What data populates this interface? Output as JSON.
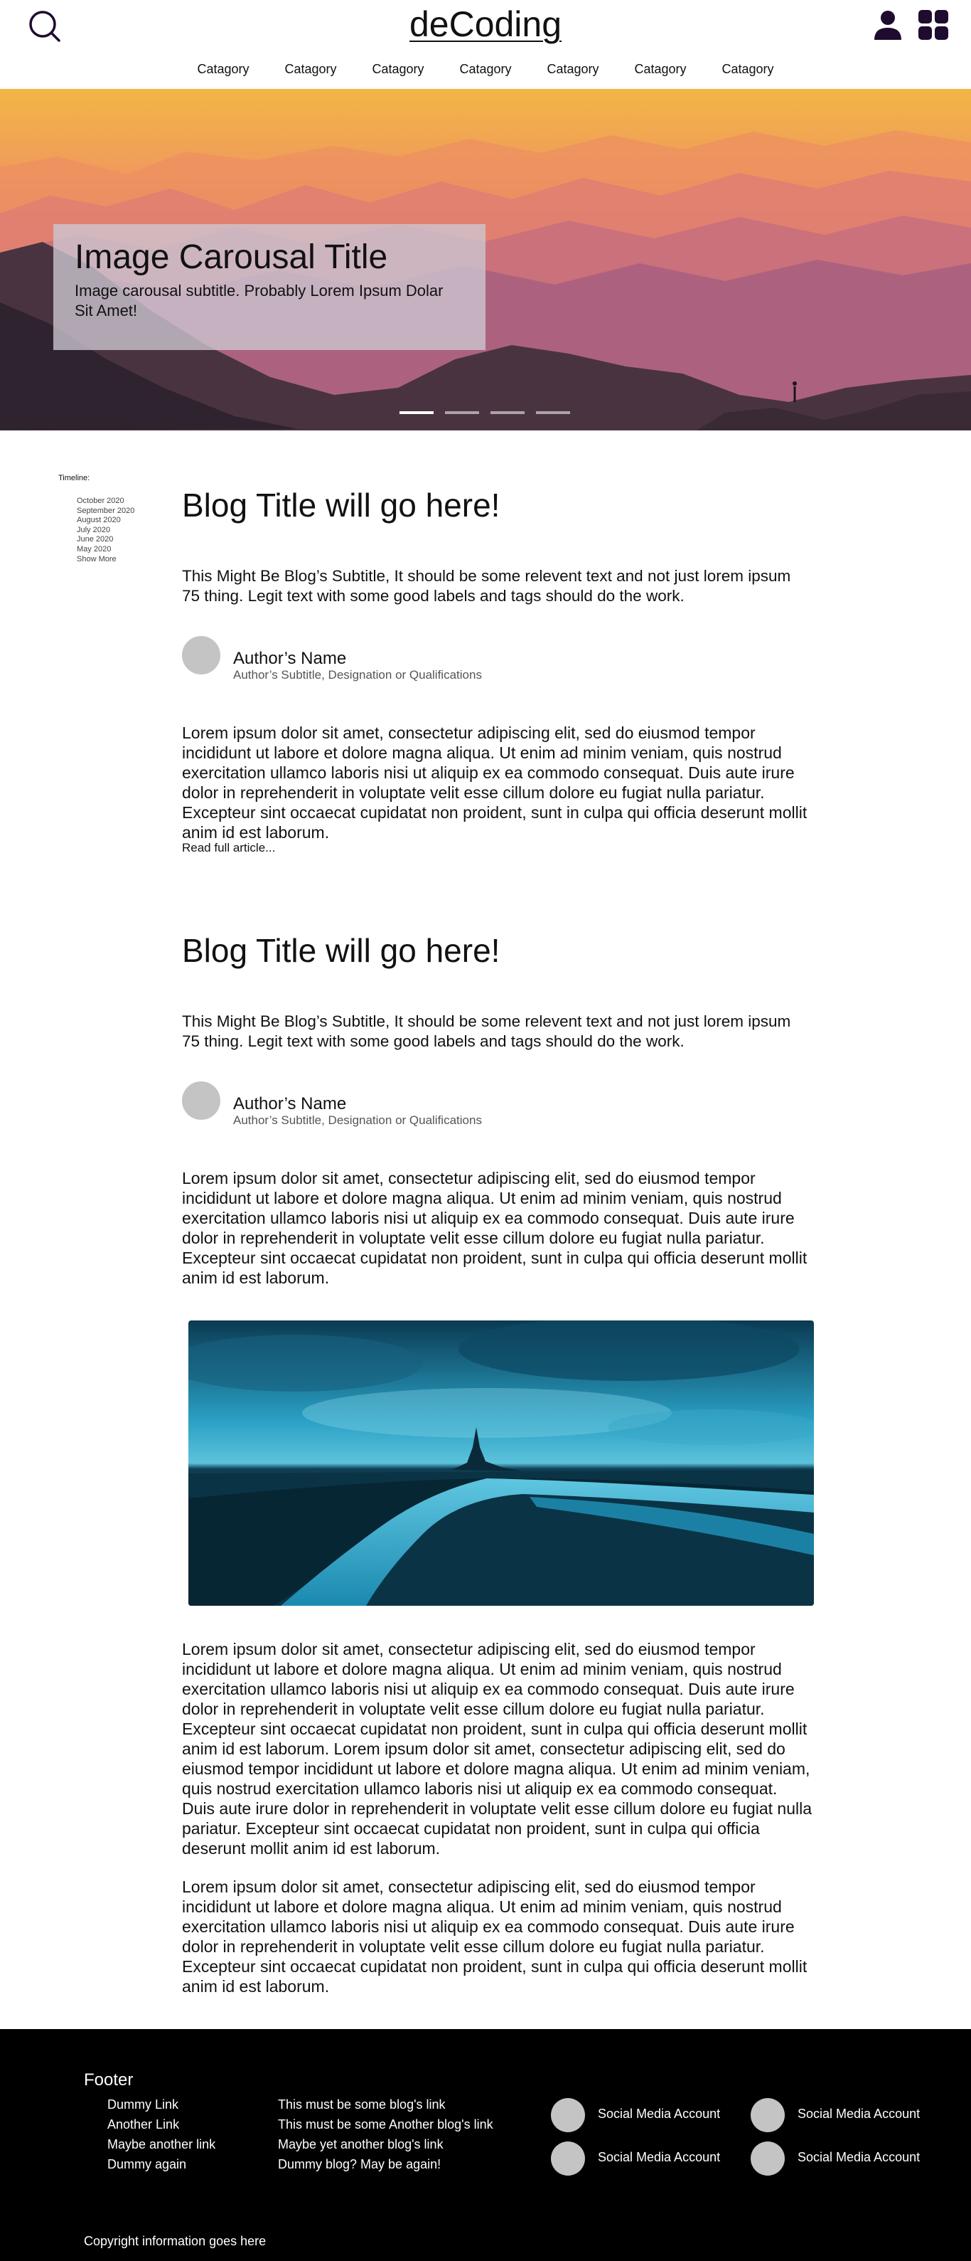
{
  "header": {
    "logo": "deCoding",
    "nav": [
      "Catagory",
      "Catagory",
      "Catagory",
      "Catagory",
      "Catagory",
      "Catagory",
      "Catagory"
    ],
    "icons": [
      "search-icon",
      "user-icon",
      "apps-grid-icon"
    ]
  },
  "hero": {
    "title": "Image Carousal Title",
    "subtitle": "Image carousal subtitle. Probably Lorem Ipsum Dolar Sit Amet!",
    "slides_count": 4,
    "active_slide": 1
  },
  "timeline": {
    "label": "Timeline:",
    "items": [
      "October 2020",
      "September 2020",
      "August 2020",
      "July 2020",
      "June 2020",
      "May 2020"
    ],
    "more": "Show More"
  },
  "articles": [
    {
      "title": "Blog Title will go here!",
      "subtitle": "This Might Be Blog’s Subtitle, It should be some relevent text and not just lorem ipsum 75 thing. Legit text with some good labels and tags should do the work.",
      "author_name": "Author’s Name",
      "author_subtitle": "Author’s Subtitle, Designation or Qualifications",
      "excerpt": "Lorem ipsum dolor sit amet, consectetur adipiscing elit, sed do eiusmod tempor incididunt ut labore et dolore magna aliqua. Ut enim ad minim veniam, quis nostrud exercitation ullamco laboris nisi ut aliquip ex ea commodo consequat. Duis aute irure dolor in reprehenderit in voluptate velit esse cillum dolore eu fugiat nulla pariatur. Excepteur sint occaecat cupidatat non proident, sunt in culpa qui officia deserunt mollit anim id est laborum.",
      "read_more": "Read full article..."
    },
    {
      "title": "Blog Title will go here!",
      "subtitle": "This Might Be Blog’s Subtitle, It should be some relevent text and not just lorem ipsum 75 thing. Legit text with some good labels and tags should do the work.",
      "author_name": "Author’s Name",
      "author_subtitle": "Author’s Subtitle, Designation or Qualifications",
      "paragraph_1": "Lorem ipsum dolor sit amet, consectetur adipiscing elit, sed do eiusmod tempor incididunt ut labore et dolore magna aliqua. Ut enim ad minim veniam, quis nostrud exercitation ullamco laboris nisi ut aliquip ex ea commodo consequat. Duis aute irure dolor in reprehenderit in voluptate velit esse cillum dolore eu fugiat nulla pariatur. Excepteur sint occaecat cupidatat non proident, sunt in culpa qui officia deserunt mollit anim id est laborum.",
      "paragraph_2": "Lorem ipsum dolor sit amet, consectetur adipiscing elit, sed do eiusmod tempor incididunt ut labore et dolore magna aliqua. Ut enim ad minim veniam, quis nostrud exercitation ullamco laboris nisi ut aliquip ex ea commodo consequat. Duis aute irure dolor in reprehenderit in voluptate velit esse cillum dolore eu fugiat nulla pariatur. Excepteur sint occaecat cupidatat non proident, sunt in culpa qui officia deserunt mollit anim id est laborum. Lorem ipsum dolor sit amet, consectetur adipiscing elit, sed do eiusmod tempor incididunt ut labore et dolore magna aliqua. Ut enim ad minim veniam, quis nostrud exercitation ullamco laboris nisi ut aliquip ex ea commodo consequat. Duis aute irure dolor in reprehenderit in voluptate velit esse cillum dolore eu fugiat nulla pariatur. Excepteur sint occaecat cupidatat non proident, sunt in culpa qui officia deserunt mollit anim id est laborum.",
      "paragraph_3": "Lorem ipsum dolor sit amet, consectetur adipiscing elit, sed do eiusmod tempor incididunt ut labore et dolore magna aliqua. Ut enim ad minim veniam, quis nostrud exercitation ullamco laboris nisi ut aliquip ex ea commodo consequat. Duis aute irure dolor in reprehenderit in voluptate velit esse cillum dolore eu fugiat nulla pariatur. Excepteur sint occaecat cupidatat non proident, sunt in culpa qui officia deserunt mollit anim id est laborum."
    }
  ],
  "footer": {
    "heading": "Footer",
    "links": [
      "Dummy Link",
      "Another Link",
      "Maybe another link",
      "Dummy again"
    ],
    "blog_links": [
      "This must be some blog's link",
      "This must be some Another blog's link",
      "Maybe yet another blog's link",
      "Dummy blog? May be again!"
    ],
    "social": [
      "Social Media Account",
      "Social Media Account",
      "Social Media Account",
      "Social Media Account"
    ],
    "copyright": "Copyright information goes here"
  },
  "colors": {
    "icon": "#1e0b2e",
    "footer_bg": "#000000",
    "avatar": "#c4c4c4"
  }
}
